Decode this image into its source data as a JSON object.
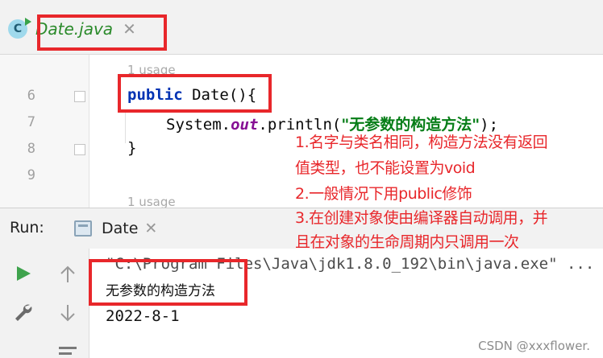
{
  "editor_tab": {
    "icon_letter": "C",
    "file_name": "Date.java",
    "close_glyph": "✕"
  },
  "editor": {
    "usage_hint_1": "1 usage",
    "usage_hint_2": "1 usage",
    "line_numbers": [
      "6",
      "7",
      "8",
      "9"
    ],
    "line6": {
      "keyword": "public",
      "rest": " Date(){"
    },
    "line7": {
      "prefix": "System.",
      "field": "out",
      "call": ".println(",
      "string": "\"无参数的构造方法\"",
      "suffix": ");"
    },
    "line8": "}"
  },
  "run_panel": {
    "label": "Run:",
    "tab_name": "Date",
    "close_glyph": "✕",
    "command": "\"C:\\Program Files\\Java\\jdk1.8.0_192\\bin\\java.exe\" ...",
    "output_lines": [
      "无参数的构造方法",
      "2022-8-1"
    ]
  },
  "annotation_notes": [
    "1.名字与类名相同，构造方法没有返回",
    "值类型，也不能设置为void",
    "2.一般情况下用public修饰",
    "3.在创建对象使由编译器自动调用，并",
    "且在对象的生命周期内只调用一次"
  ],
  "watermark": "CSDN @xxxflower.",
  "colors": {
    "annotation_red": "#e8272b",
    "keyword_blue": "#0033b3",
    "string_green": "#067d17",
    "field_purple": "#871094"
  }
}
